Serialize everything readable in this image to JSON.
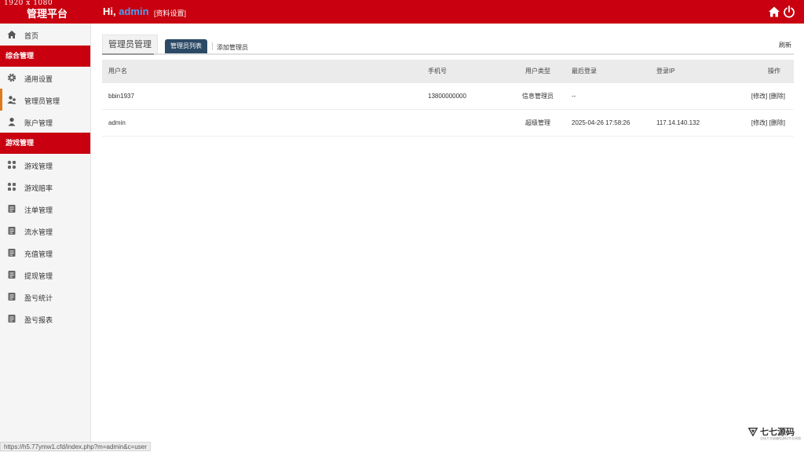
{
  "overlay": {
    "resolution_note": "1920 x 1080"
  },
  "header": {
    "brand": "管理平台",
    "greeting_prefix": "Hi, ",
    "username": "admin",
    "profile_link": "[资料设置]",
    "icons": [
      "home-icon",
      "power-icon"
    ]
  },
  "sidebar": {
    "items_top": [
      {
        "label": "首页",
        "icon": "home-icon"
      }
    ],
    "section1": "综合管理",
    "items_s1": [
      {
        "label": "通用设置",
        "icon": "gear-icon"
      },
      {
        "label": "管理员管理",
        "icon": "users-icon",
        "active": true
      },
      {
        "label": "账户管理",
        "icon": "user-icon"
      }
    ],
    "section2": "游戏管理",
    "items_s2": [
      {
        "label": "游戏管理",
        "icon": "apps-icon"
      },
      {
        "label": "游戏赔率",
        "icon": "apps-icon"
      },
      {
        "label": "注单管理",
        "icon": "list-icon"
      },
      {
        "label": "流水管理",
        "icon": "list-icon"
      },
      {
        "label": "充值管理",
        "icon": "list-icon"
      },
      {
        "label": "提现管理",
        "icon": "list-icon"
      },
      {
        "label": "盈亏统计",
        "icon": "list-icon"
      },
      {
        "label": "盈亏报表",
        "icon": "list-icon"
      }
    ],
    "accent_color": "#c8000f"
  },
  "main": {
    "title": "管理员管理",
    "tabs": [
      {
        "label": "管理员列表",
        "active": true
      },
      {
        "label": "添加管理员",
        "active": false
      }
    ],
    "refresh": "刷新",
    "table": {
      "headers": [
        "用户名",
        "手机号",
        "用户类型",
        "最后登录",
        "登录IP",
        "操作"
      ],
      "rows": [
        {
          "username": "bbin1937",
          "phone": "13800000000",
          "type": "信息管理员",
          "last_login": "--",
          "ip": "",
          "edit": "[修改]",
          "delete": "[删除]"
        },
        {
          "username": "admin",
          "phone": "",
          "type": "超级管理",
          "last_login": "2025-04-26 17:58:26",
          "ip": "117.14.140.132",
          "edit": "[修改]",
          "delete": "[删除]"
        }
      ]
    }
  },
  "statusbar": {
    "url": "https://h5.77ymw1.cfd/index.php?m=admin&c=user"
  },
  "watermark": {
    "text": "七七源码",
    "sub": "全球大学副编程源码专业网络"
  }
}
